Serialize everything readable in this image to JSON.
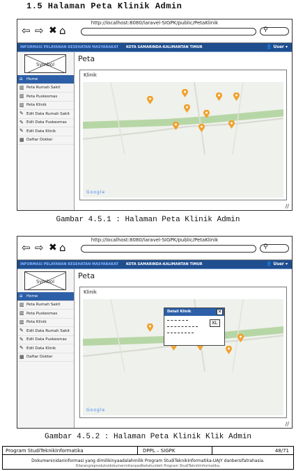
{
  "section_heading": "1.5   Halaman Peta Klinik Admin",
  "browser": {
    "url": "http://localhost:8080/laravel-SIGPK/public/PetaKlinik"
  },
  "app": {
    "title": "INFORMASI PELAYANAN KESEHATAN MASYARAKAT",
    "city": "KOTA SAMARINDA-KALIMANTAN TIMUR",
    "user_label": "User"
  },
  "sidebar": {
    "logo_label": "Symbol",
    "menu": [
      {
        "label": "Home",
        "icon": "home-icon"
      },
      {
        "label": "Peta Rumah Sakit",
        "icon": "map-icon"
      },
      {
        "label": "Peta Puskesmas",
        "icon": "map-icon"
      },
      {
        "label": "Peta Klinik",
        "icon": "map-icon"
      },
      {
        "label": "Edit Data Rumah Sakit",
        "icon": "pencil-icon"
      },
      {
        "label": "Edit Data Puskesmas",
        "icon": "pencil-icon"
      },
      {
        "label": "Edit Data Klinik",
        "icon": "pencil-icon"
      },
      {
        "label": "Daftar Dokter",
        "icon": "table-icon"
      }
    ]
  },
  "page": {
    "title": "Peta",
    "panel_label": "Klinik",
    "google_label": "Google"
  },
  "popup": {
    "title": "Detail Klinik",
    "button": "KL"
  },
  "captions": {
    "figure1": "Gambar 4.5.1 : Halaman Peta Klinik Admin",
    "figure2": "Gambar 4.5.2 : Halaman Peta Klinik Klik Admin"
  },
  "footer": {
    "program": "Program StudiTeknikInformatika",
    "doc": "DPPL – SIGPK",
    "page": "48/71",
    "note": "Dokumeninidaninformasi yang dimilikinyaadalahmilik Program StudiTeknikInformatika-UAJY danbersifatrahasia.",
    "note2": "Dilarangreproduksidokumeninitanpadiketahuioleh Program StudiTeknikInformatika."
  },
  "colors": {
    "appbar": "#1f4e8f",
    "active_menu": "#2c5fa8",
    "pin": "#f2a02b",
    "road_green": "#b7d6a5"
  }
}
